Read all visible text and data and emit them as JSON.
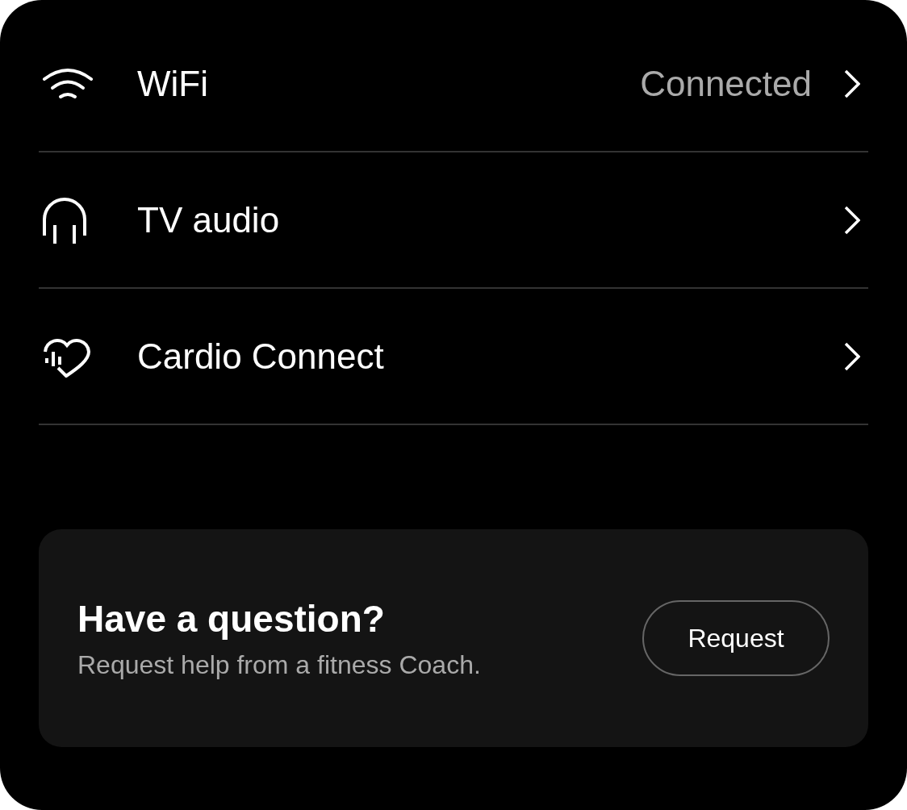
{
  "settings": [
    {
      "label": "WiFi",
      "value": "Connected"
    },
    {
      "label": "TV audio"
    },
    {
      "label": "Cardio Connect"
    }
  ],
  "help_card": {
    "title": "Have a question?",
    "subtitle": "Request help from a fitness Coach.",
    "button": "Request"
  }
}
